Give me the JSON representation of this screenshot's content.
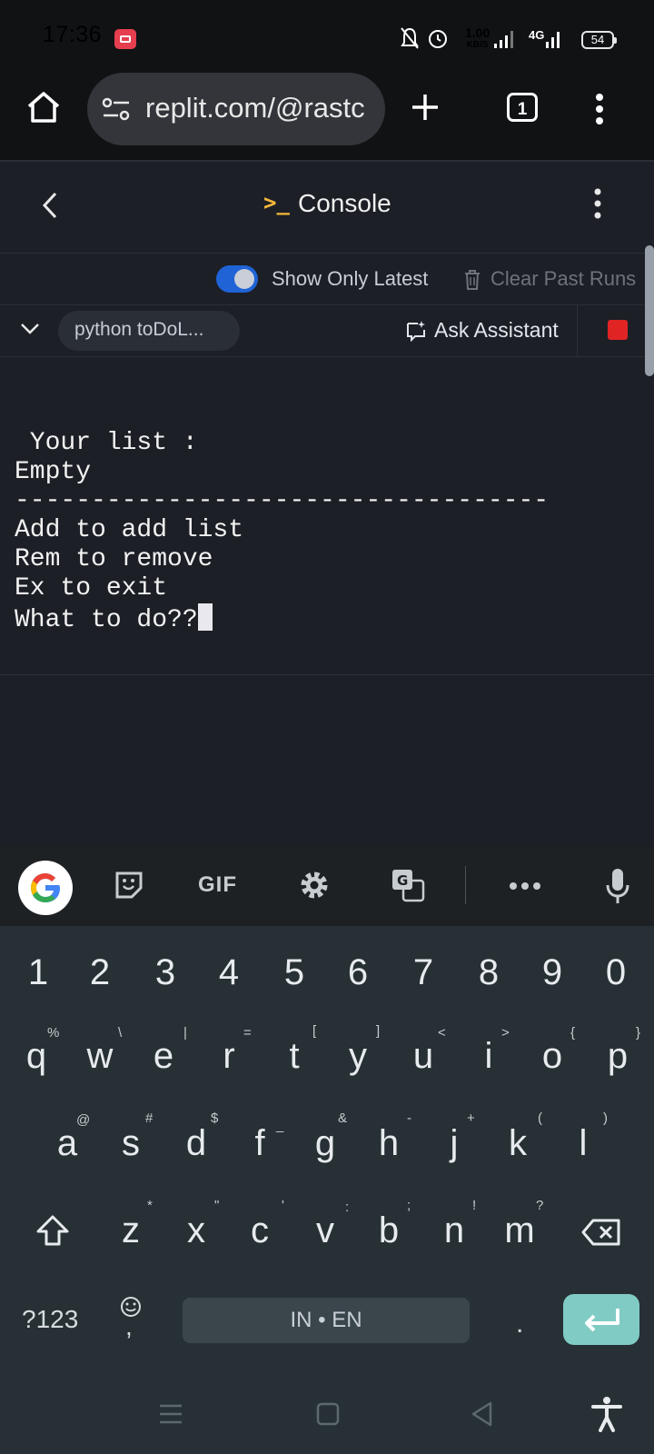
{
  "status_bar": {
    "time": "17:36",
    "speed_value": "1.00",
    "speed_unit": "KB/S",
    "network": "4G",
    "battery": "54"
  },
  "browser": {
    "url": "replit.com/@rastc",
    "tab_count": "1"
  },
  "console": {
    "title": "Console",
    "show_latest_label": "Show Only Latest",
    "clear_runs_label": "Clear Past Runs",
    "run_name": "python toDoL...",
    "ask_assistant_label": "Ask Assistant",
    "output": " Your list :\nEmpty\n-----------------------------------\nAdd to add list\nRem to remove\nEx to exit\nWhat to do??"
  },
  "keyboard": {
    "toolbar_gif": "GIF",
    "number_row": [
      "1",
      "2",
      "3",
      "4",
      "5",
      "6",
      "7",
      "8",
      "9",
      "0"
    ],
    "row1": [
      "q",
      "w",
      "e",
      "r",
      "t",
      "y",
      "u",
      "i",
      "o",
      "p"
    ],
    "row1_hints": [
      "%",
      "\\",
      "|",
      "=",
      "[",
      "]",
      "<",
      ">",
      "{",
      "}"
    ],
    "row2": [
      "a",
      "s",
      "d",
      "f",
      "g",
      "h",
      "j",
      "k",
      "l"
    ],
    "row2_hints": [
      "@",
      "#",
      "$",
      "_",
      "&",
      "-",
      "+",
      "(",
      ")"
    ],
    "row3": [
      "z",
      "x",
      "c",
      "v",
      "b",
      "n",
      "m"
    ],
    "row3_hints": [
      "*",
      "\"",
      "'",
      ":",
      ";",
      "!",
      "?"
    ],
    "symbols_label": "?123",
    "comma": ",",
    "space_label": "IN • EN",
    "period": "."
  },
  "colors": {
    "accent_blue": "#1f63d6",
    "stop_red": "#e02424",
    "enter_teal": "#80cbc4",
    "prompt_yellow": "#f5b83b"
  }
}
